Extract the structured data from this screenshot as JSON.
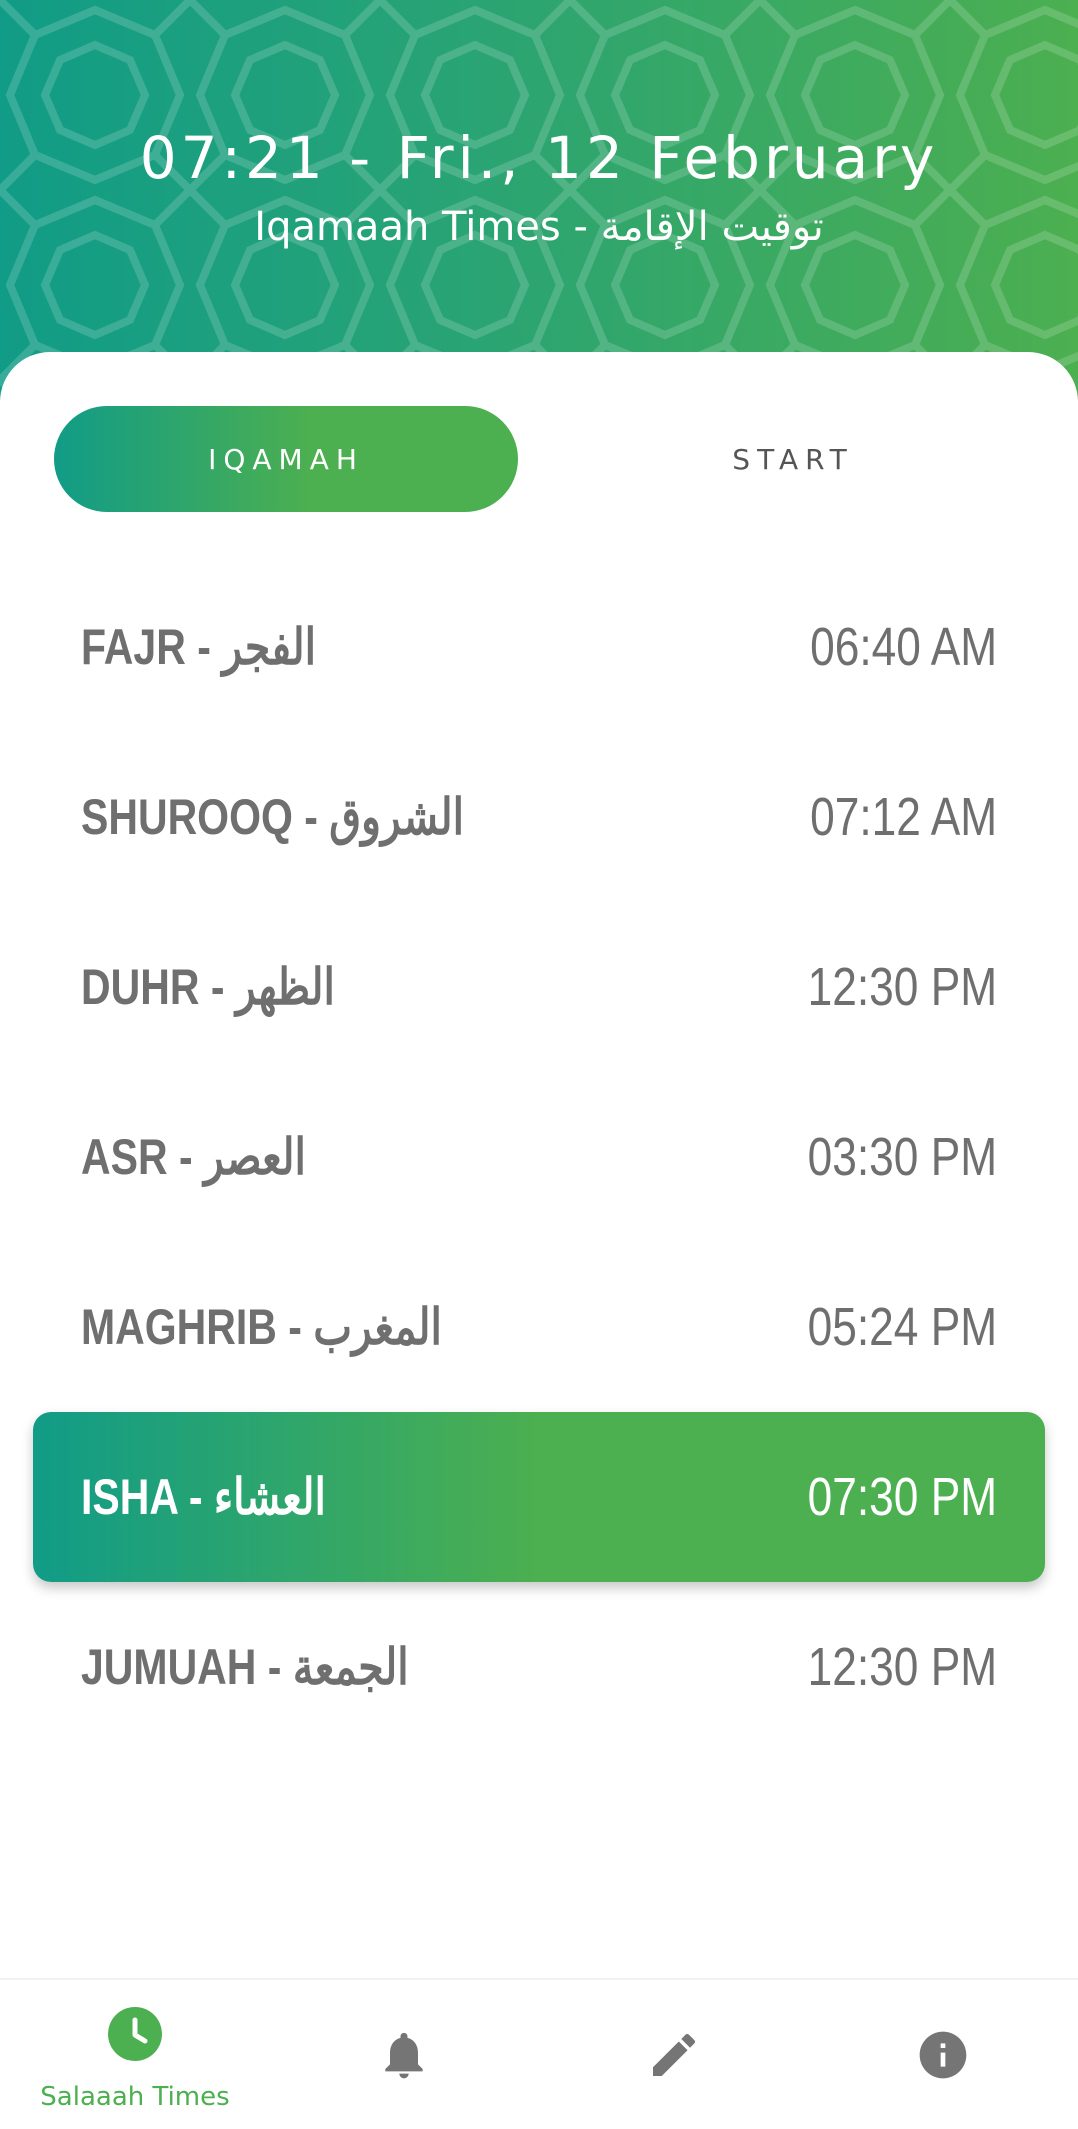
{
  "header": {
    "datetime": "07:21 - Fri., 12 February",
    "subtitle": "Iqamaah Times - توقيت الإقامة"
  },
  "tabs": [
    {
      "label": "IQAMAH",
      "selected": true
    },
    {
      "label": "START",
      "selected": false
    }
  ],
  "prayers": [
    {
      "name": "FAJR - الفجر",
      "time": "06:40 AM",
      "active": false
    },
    {
      "name": "SHUROOQ - الشروق",
      "time": "07:12 AM",
      "active": false
    },
    {
      "name": "DUHR - الظهر",
      "time": "12:30 PM",
      "active": false
    },
    {
      "name": "ASR - العصر",
      "time": "03:30 PM",
      "active": false
    },
    {
      "name": "MAGHRIB - المغرب",
      "time": "05:24 PM",
      "active": false
    },
    {
      "name": "ISHA - العشاء",
      "time": "07:30 PM",
      "active": true
    },
    {
      "name": "JUMUAH - الجمعة",
      "time": "12:30 PM",
      "active": false
    }
  ],
  "bottom_nav": [
    {
      "icon": "clock-icon",
      "label": "Salaaah Times",
      "selected": true
    },
    {
      "icon": "bell-icon",
      "label": "",
      "selected": false
    },
    {
      "icon": "pencil-icon",
      "label": "",
      "selected": false
    },
    {
      "icon": "info-icon",
      "label": "",
      "selected": false
    }
  ],
  "colors": {
    "gradient_start": "#119c87",
    "gradient_end": "#4caf50",
    "text_gray": "#6f6f6f",
    "icon_gray": "#757575",
    "accent_green": "#4caf50"
  }
}
